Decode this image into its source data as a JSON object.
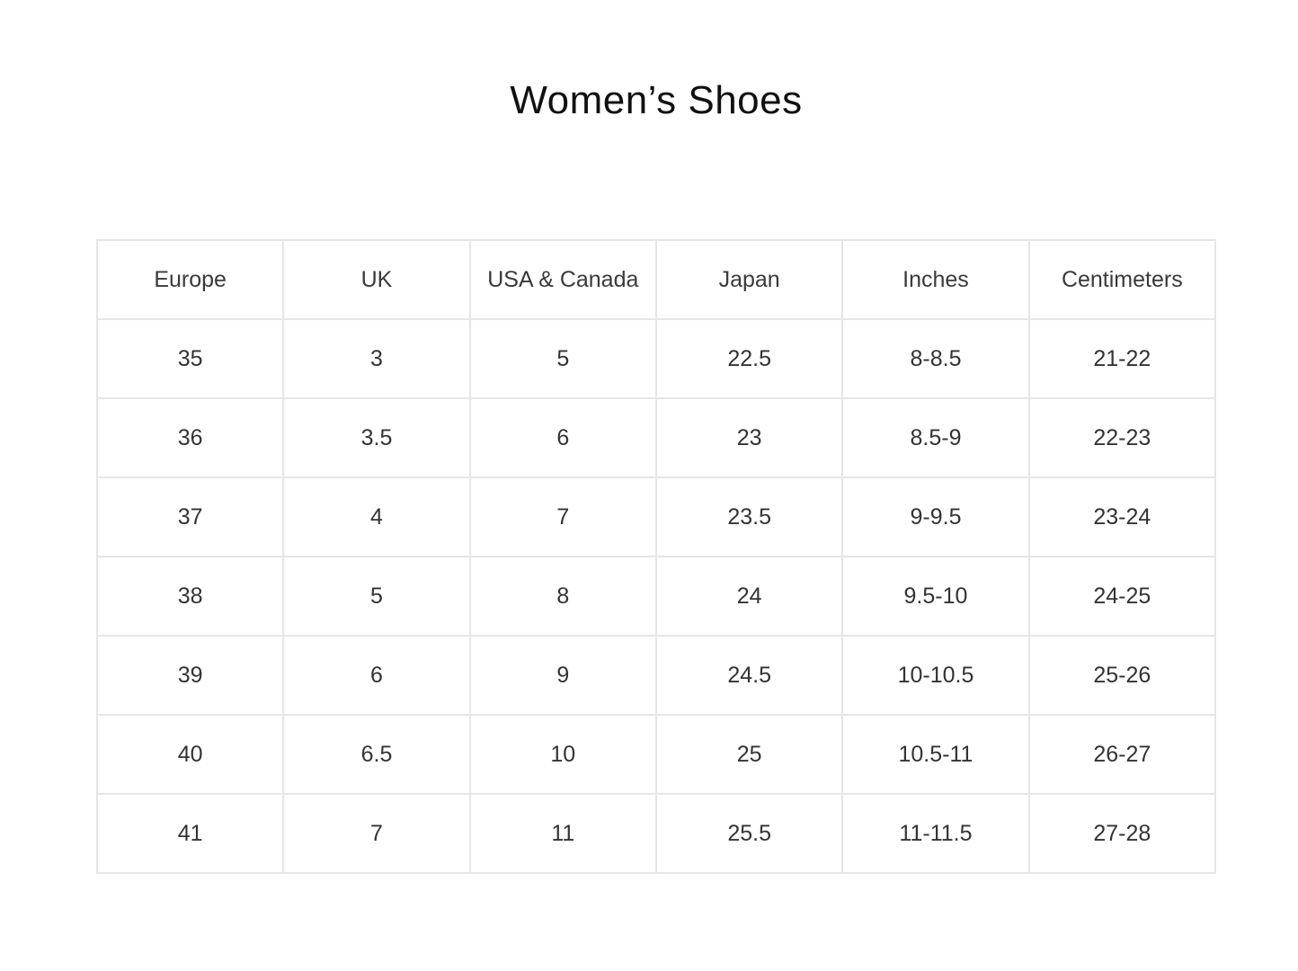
{
  "title": "Women’s Shoes",
  "table": {
    "headers": [
      "Europe",
      "UK",
      "USA & Canada",
      "Japan",
      "Inches",
      "Centimeters"
    ],
    "rows": [
      [
        "35",
        "3",
        "5",
        "22.5",
        "8-8.5",
        "21-22"
      ],
      [
        "36",
        "3.5",
        "6",
        "23",
        "8.5-9",
        "22-23"
      ],
      [
        "37",
        "4",
        "7",
        "23.5",
        "9-9.5",
        "23-24"
      ],
      [
        "38",
        "5",
        "8",
        "24",
        "9.5-10",
        "24-25"
      ],
      [
        "39",
        "6",
        "9",
        "24.5",
        "10-10.5",
        "25-26"
      ],
      [
        "40",
        "6.5",
        "10",
        "25",
        "10.5-11",
        "26-27"
      ],
      [
        "41",
        "7",
        "11",
        "25.5",
        "11-11.5",
        "27-28"
      ]
    ]
  }
}
